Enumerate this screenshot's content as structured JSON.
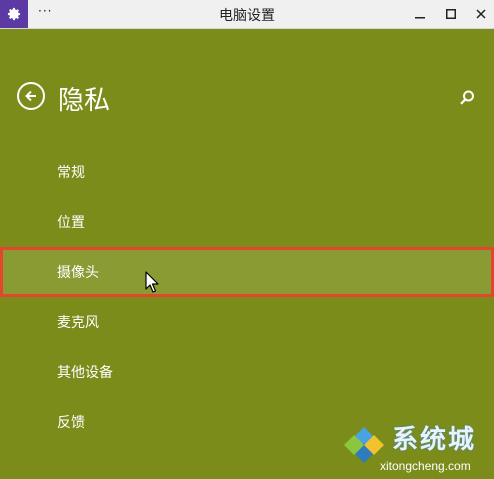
{
  "window": {
    "title": "电脑设置",
    "menu_dots": "···",
    "icons": {
      "app": "gear-icon",
      "minimize": "minimize-icon",
      "maximize": "maximize-icon",
      "close": "close-icon"
    }
  },
  "header": {
    "title": "隐私",
    "back_icon": "back-arrow-icon",
    "search_icon": "search-icon"
  },
  "nav": {
    "items": [
      {
        "label": "常规",
        "selected": false
      },
      {
        "label": "位置",
        "selected": false
      },
      {
        "label": "摄像头",
        "selected": true
      },
      {
        "label": "麦克风",
        "selected": false
      },
      {
        "label": "其他设备",
        "selected": false
      },
      {
        "label": "反馈",
        "selected": false
      }
    ]
  },
  "watermark": {
    "text": "系统城",
    "url": "xitongcheng.com"
  },
  "colors": {
    "background": "#7b8c1a",
    "selected_background": "#8a9b34",
    "highlight_border": "#e2462d",
    "titlebar": "#f0f0f0",
    "app_icon": "#5b3aa3"
  }
}
